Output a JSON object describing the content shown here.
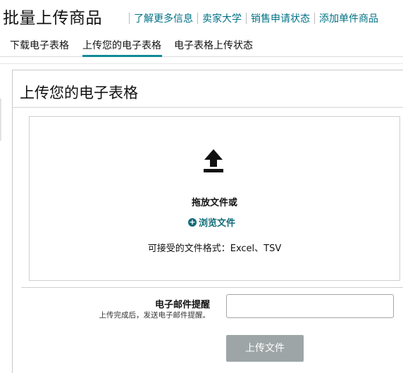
{
  "header": {
    "title": "批量上传商品",
    "links": [
      "了解更多信息",
      "卖家大学",
      "销售申请状态",
      "添加单件商品"
    ]
  },
  "tabs": [
    {
      "label": "下载电子表格",
      "active": false
    },
    {
      "label": "上传您的电子表格",
      "active": true
    },
    {
      "label": "电子表格上传状态",
      "active": false
    }
  ],
  "panel": {
    "title": "上传您的电子表格",
    "dropzone": {
      "icon": "upload-icon",
      "drop_text": "拖放文件或",
      "browse_label": "浏览文件",
      "formats_text": "可接受的文件格式：Excel、TSV"
    },
    "email": {
      "label": "电子邮件提醒",
      "sublabel": "上传完成后，发送电子邮件提醒。",
      "value": "",
      "placeholder": ""
    },
    "upload_button_label": "上传文件"
  },
  "colors": {
    "accent": "#007185",
    "tab_underline": "#0f8a96",
    "button_disabled": "#9ea5a7"
  }
}
